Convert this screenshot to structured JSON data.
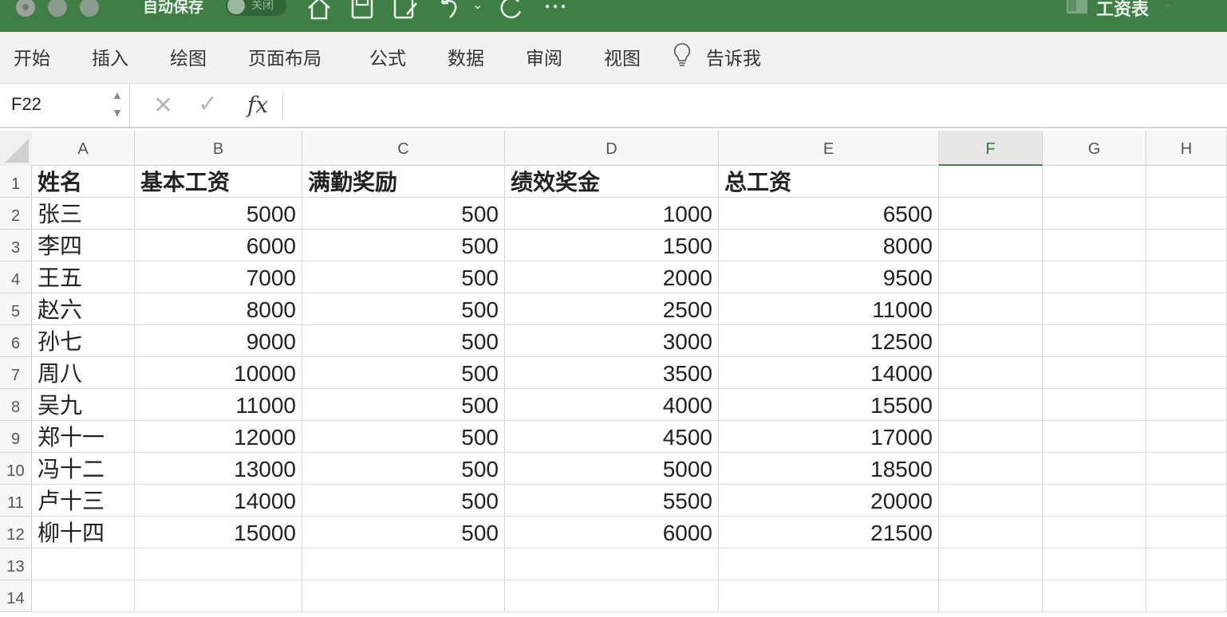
{
  "titlebar": {
    "autosave_label": "自动保存",
    "autosave_state": "关闭",
    "doc_title": "工资表",
    "bg_color": "#3f7f46"
  },
  "ribbon": {
    "tabs": [
      "开始",
      "插入",
      "绘图",
      "页面布局",
      "公式",
      "数据",
      "审阅",
      "视图"
    ],
    "tell_me": "告诉我"
  },
  "formula_bar": {
    "name_box": "F22",
    "fx_label": "fx",
    "formula": ""
  },
  "sheet": {
    "columns": [
      "A",
      "B",
      "C",
      "D",
      "E",
      "F",
      "G",
      "H"
    ],
    "active_column": "F",
    "rows": [
      {
        "n": "1",
        "cells": [
          "姓名",
          "基本工资",
          "满勤奖励",
          "绩效奖金",
          "总工资"
        ]
      },
      {
        "n": "2",
        "cells": [
          "张三",
          "5000",
          "500",
          "1000",
          "6500"
        ]
      },
      {
        "n": "3",
        "cells": [
          "李四",
          "6000",
          "500",
          "1500",
          "8000"
        ]
      },
      {
        "n": "4",
        "cells": [
          "王五",
          "7000",
          "500",
          "2000",
          "9500"
        ]
      },
      {
        "n": "5",
        "cells": [
          "赵六",
          "8000",
          "500",
          "2500",
          "11000"
        ]
      },
      {
        "n": "6",
        "cells": [
          "孙七",
          "9000",
          "500",
          "3000",
          "12500"
        ]
      },
      {
        "n": "7",
        "cells": [
          "周八",
          "10000",
          "500",
          "3500",
          "14000"
        ]
      },
      {
        "n": "8",
        "cells": [
          "吴九",
          "11000",
          "500",
          "4000",
          "15500"
        ]
      },
      {
        "n": "9",
        "cells": [
          "郑十一",
          "12000",
          "500",
          "4500",
          "17000"
        ]
      },
      {
        "n": "10",
        "cells": [
          "冯十二",
          "13000",
          "500",
          "5000",
          "18500"
        ]
      },
      {
        "n": "11",
        "cells": [
          "卢十三",
          "14000",
          "500",
          "5500",
          "20000"
        ]
      },
      {
        "n": "12",
        "cells": [
          "柳十四",
          "15000",
          "500",
          "6000",
          "21500"
        ]
      },
      {
        "n": "13",
        "cells": []
      },
      {
        "n": "14",
        "cells": []
      }
    ]
  }
}
